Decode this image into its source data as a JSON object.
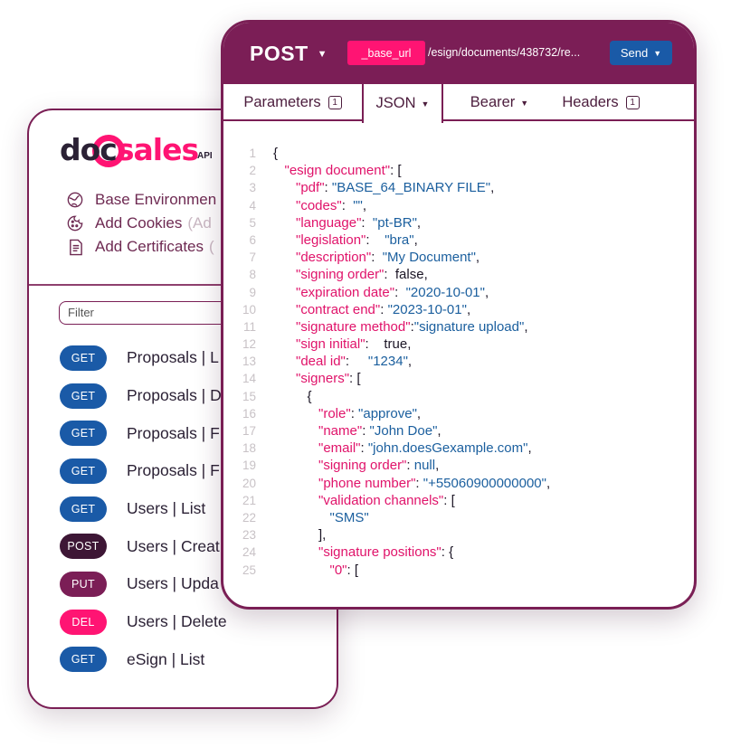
{
  "logo": {
    "part1": "doc",
    "part2": "sales",
    "suffix": "API"
  },
  "sidebar": {
    "env_items": [
      {
        "icon": "globe-icon",
        "label": "Base Environmen"
      },
      {
        "icon": "cookie-icon",
        "label": "Add Cookies",
        "hint": "(Ad"
      },
      {
        "icon": "certificate-icon",
        "label": "Add Certificates",
        "hint": "("
      }
    ],
    "filter_placeholder": "Filter",
    "endpoints": [
      {
        "method": "GET",
        "color": "#1a5aa7",
        "label": "Proposals | L"
      },
      {
        "method": "GET",
        "color": "#1a5aa7",
        "label": "Proposals | D"
      },
      {
        "method": "GET",
        "color": "#1a5aa7",
        "label": "Proposals | F"
      },
      {
        "method": "GET",
        "color": "#1a5aa7",
        "label": "Proposals | F"
      },
      {
        "method": "GET",
        "color": "#1a5aa7",
        "label": "Users | List"
      },
      {
        "method": "POST",
        "color": "#3d1635",
        "label": "Users | Creat"
      },
      {
        "method": "PUT",
        "color": "#7b1e56",
        "label": "Users | Upda"
      },
      {
        "method": "DEL",
        "color": "#ff1473",
        "label": "Users | Delete"
      },
      {
        "method": "GET",
        "color": "#1a5aa7",
        "label": "eSign | List"
      }
    ]
  },
  "request": {
    "method": "POST",
    "base_url": "_base_url",
    "path": "/esign/documents/438732/re...",
    "send_label": "Send",
    "tabs": [
      {
        "label": "Parameters",
        "count": "1"
      },
      {
        "label": "JSON",
        "active": true
      },
      {
        "label": "Bearer"
      },
      {
        "label": "Headers",
        "count": "1"
      }
    ]
  },
  "colors": {
    "brand_purple": "#7b1e56",
    "brand_pink": "#ff1473",
    "brand_blue": "#1a5aa7"
  },
  "code_lines": [
    [
      {
        "t": "{",
        "c": "p"
      }
    ],
    [
      {
        "t": "   ",
        "c": "p"
      },
      {
        "t": "\"esign document\"",
        "c": "k"
      },
      {
        "t": ": [",
        "c": "p"
      }
    ],
    [
      {
        "t": "      ",
        "c": "p"
      },
      {
        "t": "\"pdf\"",
        "c": "k"
      },
      {
        "t": ": ",
        "c": "p"
      },
      {
        "t": "\"BASE_64_BINARY FILE\"",
        "c": "s"
      },
      {
        "t": ",",
        "c": "p"
      }
    ],
    [
      {
        "t": "      ",
        "c": "p"
      },
      {
        "t": "\"codes\"",
        "c": "k"
      },
      {
        "t": ":  ",
        "c": "p"
      },
      {
        "t": "\"\"",
        "c": "s"
      },
      {
        "t": ",",
        "c": "p"
      }
    ],
    [
      {
        "t": "      ",
        "c": "p"
      },
      {
        "t": "\"language\"",
        "c": "k"
      },
      {
        "t": ":  ",
        "c": "p"
      },
      {
        "t": "\"pt-BR\"",
        "c": "s"
      },
      {
        "t": ",",
        "c": "p"
      }
    ],
    [
      {
        "t": "      ",
        "c": "p"
      },
      {
        "t": "\"legislation\"",
        "c": "k"
      },
      {
        "t": ":    ",
        "c": "p"
      },
      {
        "t": "\"bra\"",
        "c": "s"
      },
      {
        "t": ",",
        "c": "p"
      }
    ],
    [
      {
        "t": "      ",
        "c": "p"
      },
      {
        "t": "\"description\"",
        "c": "k"
      },
      {
        "t": ":  ",
        "c": "p"
      },
      {
        "t": "\"My Document\"",
        "c": "s"
      },
      {
        "t": ",",
        "c": "p"
      }
    ],
    [
      {
        "t": "      ",
        "c": "p"
      },
      {
        "t": "\"signing order\"",
        "c": "k"
      },
      {
        "t": ":  false,",
        "c": "p"
      }
    ],
    [
      {
        "t": "      ",
        "c": "p"
      },
      {
        "t": "\"expiration date\"",
        "c": "k"
      },
      {
        "t": ":  ",
        "c": "p"
      },
      {
        "t": "\"2020-10-01\"",
        "c": "s"
      },
      {
        "t": ",",
        "c": "p"
      }
    ],
    [
      {
        "t": "      ",
        "c": "p"
      },
      {
        "t": "\"contract end\"",
        "c": "k"
      },
      {
        "t": ": ",
        "c": "p"
      },
      {
        "t": "\"2023-10-01\"",
        "c": "s"
      },
      {
        "t": ",",
        "c": "p"
      }
    ],
    [
      {
        "t": "      ",
        "c": "p"
      },
      {
        "t": "\"signature method\"",
        "c": "k"
      },
      {
        "t": ":",
        "c": "p"
      },
      {
        "t": "\"signature upload\"",
        "c": "s"
      },
      {
        "t": ",",
        "c": "p"
      }
    ],
    [
      {
        "t": "      ",
        "c": "p"
      },
      {
        "t": "\"sign initial\"",
        "c": "k"
      },
      {
        "t": ":    true,",
        "c": "p"
      }
    ],
    [
      {
        "t": "      ",
        "c": "p"
      },
      {
        "t": "\"deal id\"",
        "c": "k"
      },
      {
        "t": ":     ",
        "c": "p"
      },
      {
        "t": "\"1234\"",
        "c": "s"
      },
      {
        "t": ",",
        "c": "p"
      }
    ],
    [
      {
        "t": "      ",
        "c": "p"
      },
      {
        "t": "\"signers\"",
        "c": "k"
      },
      {
        "t": ": [",
        "c": "p"
      }
    ],
    [
      {
        "t": "         {",
        "c": "p"
      }
    ],
    [
      {
        "t": "            ",
        "c": "p"
      },
      {
        "t": "\"role\"",
        "c": "k"
      },
      {
        "t": ": ",
        "c": "p"
      },
      {
        "t": "\"approve\"",
        "c": "s"
      },
      {
        "t": ",",
        "c": "p"
      }
    ],
    [
      {
        "t": "            ",
        "c": "p"
      },
      {
        "t": "\"name\"",
        "c": "k"
      },
      {
        "t": ": ",
        "c": "p"
      },
      {
        "t": "\"John Doe\"",
        "c": "s"
      },
      {
        "t": ",",
        "c": "p"
      }
    ],
    [
      {
        "t": "            ",
        "c": "p"
      },
      {
        "t": "\"email\"",
        "c": "k"
      },
      {
        "t": ": ",
        "c": "p"
      },
      {
        "t": "\"john.doesGexample.com\"",
        "c": "s"
      },
      {
        "t": ",",
        "c": "p"
      }
    ],
    [
      {
        "t": "            ",
        "c": "p"
      },
      {
        "t": "\"signing order\"",
        "c": "k"
      },
      {
        "t": ": ",
        "c": "p"
      },
      {
        "t": "null",
        "c": "s"
      },
      {
        "t": ",",
        "c": "p"
      }
    ],
    [
      {
        "t": "            ",
        "c": "p"
      },
      {
        "t": "\"phone number\"",
        "c": "k"
      },
      {
        "t": ": ",
        "c": "p"
      },
      {
        "t": "\"+55060900000000\"",
        "c": "s"
      },
      {
        "t": ",",
        "c": "p"
      }
    ],
    [
      {
        "t": "            ",
        "c": "p"
      },
      {
        "t": "\"validation channels\"",
        "c": "k"
      },
      {
        "t": ": [",
        "c": "p"
      }
    ],
    [
      {
        "t": "               ",
        "c": "p"
      },
      {
        "t": "\"SMS\"",
        "c": "s"
      }
    ],
    [
      {
        "t": "            ],",
        "c": "p"
      }
    ],
    [
      {
        "t": "            ",
        "c": "p"
      },
      {
        "t": "\"signature positions\"",
        "c": "k"
      },
      {
        "t": ": {",
        "c": "p"
      }
    ],
    [
      {
        "t": "               ",
        "c": "p"
      },
      {
        "t": "\"0\"",
        "c": "k"
      },
      {
        "t": ": [",
        "c": "p"
      }
    ]
  ]
}
